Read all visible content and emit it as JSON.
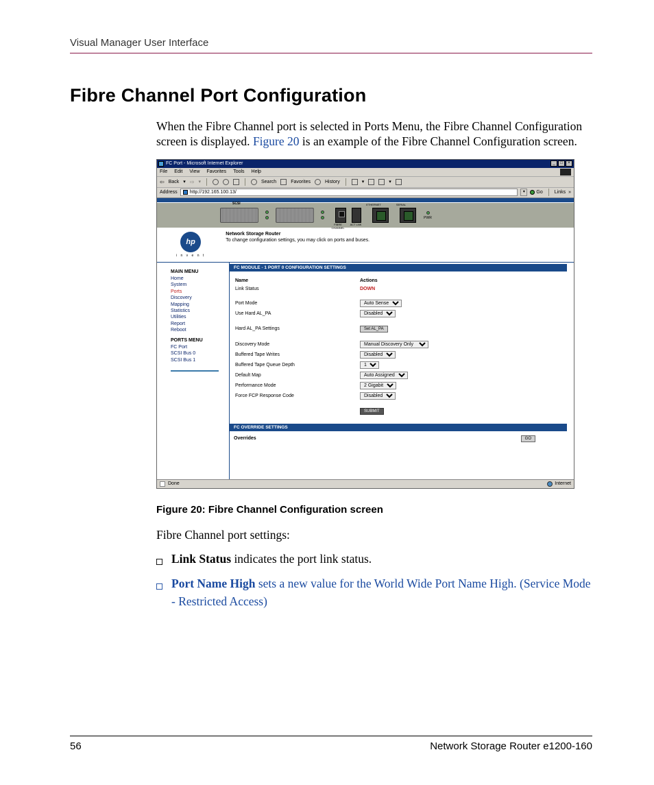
{
  "header": {
    "running_head": "Visual Manager User Interface"
  },
  "section": {
    "title": "Fibre Channel Port Configuration"
  },
  "intro": {
    "p1a": "When the Fibre Channel port is selected in Ports Menu, the Fibre Channel Configuration screen is displayed. ",
    "link": "Figure 20",
    "p1b": " is an example of the Fibre Channel Configuration screen."
  },
  "browser": {
    "title": "FC Port - Microsoft Internet Explorer",
    "menu": {
      "file": "File",
      "edit": "Edit",
      "view": "View",
      "favorites": "Favorites",
      "tools": "Tools",
      "help": "Help"
    },
    "toolbar": {
      "back": "Back",
      "search": "Search",
      "favorites": "Favorites",
      "history": "History"
    },
    "address_label": "Address",
    "address": "http://192.165.100.13/",
    "go": "Go",
    "links": "Links",
    "device": {
      "scsi": "SCSI",
      "fibre": "FIBRE CHANNEL",
      "act": "ACT LNK",
      "ethernet": "ETHERNET",
      "serial": "SERIAL",
      "pwr": "PWR"
    },
    "hp": {
      "logo": "hp",
      "invent": "i n v e n t",
      "title": "Network Storage Router",
      "sub": "To change configuration settings, you may click on ports and buses."
    },
    "sidebar": {
      "main_title": "MAIN MENU",
      "items": [
        "Home",
        "System",
        "Ports",
        "Discovery",
        "Mapping",
        "Statistics",
        "Utilities",
        "Report",
        "Reboot"
      ],
      "ports_title": "PORTS MENU",
      "ports_items": [
        "FC Port",
        "SCSI Bus 0",
        "SCSI Bus 1"
      ]
    },
    "panel": {
      "header1": "FC MODULE - 1 PORT 0 CONFIGURATION SETTINGS",
      "col_name": "Name",
      "col_actions": "Actions",
      "rows": {
        "link_status": "Link Status",
        "link_status_val": "DOWN",
        "port_mode": "Port Mode",
        "port_mode_val": "Auto Sense",
        "use_hard": "Use Hard AL_PA",
        "use_hard_val": "Disabled",
        "hard_settings": "Hard AL_PA Settings",
        "hard_btn": "Set AL_PA",
        "discovery": "Discovery Mode",
        "discovery_val": "Manual Discovery Only",
        "buf_writes": "Buffered Tape Writes",
        "buf_writes_val": "Disabled",
        "buf_depth": "Buffered Tape Queue Depth",
        "buf_depth_val": "1",
        "default_map": "Default Map",
        "default_map_val": "Auto Assigned",
        "perf": "Performance Mode",
        "perf_val": "2 Gigabit",
        "force": "Force FCP Response Code",
        "force_val": "Disabled",
        "submit": "SUBMIT"
      },
      "header2": "FC OVERRIDE SETTINGS",
      "overrides": "Overrides",
      "go": "GO"
    },
    "status": {
      "done": "Done",
      "internet": "Internet"
    }
  },
  "figure_caption": "Figure 20:  Fibre Channel Configuration screen",
  "post_text": "Fibre Channel port settings:",
  "bullets": {
    "b1_bold": "Link Status",
    "b1_rest": " indicates the port link status.",
    "b2_bold": "Port Name High",
    "b2_rest": " sets a new value for the World Wide Port Name High. (Service Mode - Restricted Access)"
  },
  "footer": {
    "page": "56",
    "doc": "Network Storage Router e1200-160"
  }
}
